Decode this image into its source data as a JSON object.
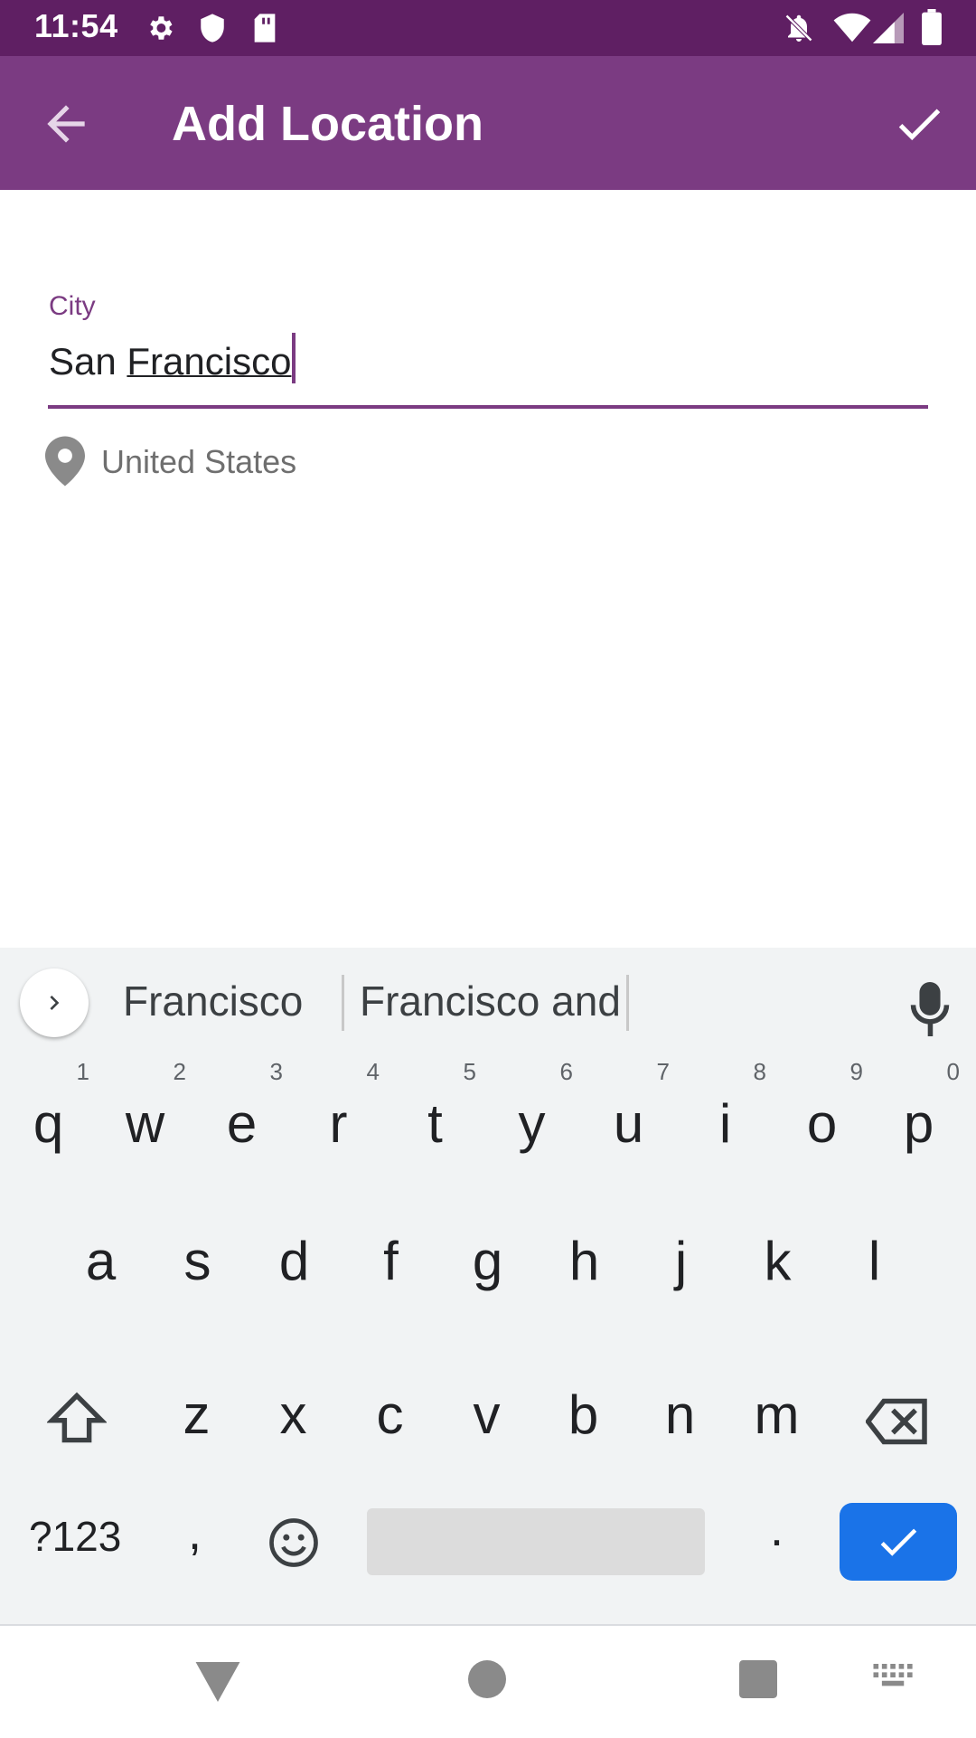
{
  "status_bar": {
    "time": "11:54",
    "icons": [
      "gear-icon",
      "shield-icon",
      "sd-card-icon",
      "notifications-off-icon",
      "wifi-icon",
      "signal-icon",
      "battery-icon"
    ]
  },
  "app_bar": {
    "title": "Add Location",
    "back_icon": "arrow-back-icon",
    "confirm_icon": "check-icon"
  },
  "form": {
    "city_label": "City",
    "city_value_plain": "San ",
    "city_value_composing": "Francisco",
    "country_icon": "location-pin-icon",
    "country": "United States"
  },
  "keyboard": {
    "suggestions": [
      "Francisco",
      "Francisco and"
    ],
    "rows": [
      [
        {
          "k": "q",
          "h": "1"
        },
        {
          "k": "w",
          "h": "2"
        },
        {
          "k": "e",
          "h": "3"
        },
        {
          "k": "r",
          "h": "4"
        },
        {
          "k": "t",
          "h": "5"
        },
        {
          "k": "y",
          "h": "6"
        },
        {
          "k": "u",
          "h": "7"
        },
        {
          "k": "i",
          "h": "8"
        },
        {
          "k": "o",
          "h": "9"
        },
        {
          "k": "p",
          "h": "0"
        }
      ],
      [
        {
          "k": "a"
        },
        {
          "k": "s"
        },
        {
          "k": "d"
        },
        {
          "k": "f"
        },
        {
          "k": "g"
        },
        {
          "k": "h"
        },
        {
          "k": "j"
        },
        {
          "k": "k"
        },
        {
          "k": "l"
        }
      ],
      [
        {
          "k": "z"
        },
        {
          "k": "x"
        },
        {
          "k": "c"
        },
        {
          "k": "v"
        },
        {
          "k": "b"
        },
        {
          "k": "n"
        },
        {
          "k": "m"
        }
      ]
    ],
    "symbols_key": "?123",
    "comma_key": ",",
    "period_key": ".",
    "emoji_icon": "emoji-icon",
    "shift_icon": "shift-icon",
    "backspace_icon": "backspace-icon",
    "enter_icon": "check-icon"
  },
  "colors": {
    "status_bar": "#5f1f63",
    "app_bar": "#7b3b82",
    "accent": "#7b3b82",
    "enter_key": "#1a73e8",
    "keyboard_bg": "#f1f3f4"
  },
  "nav_bar": {
    "icons": [
      "back-triangle-icon",
      "home-circle-icon",
      "recents-square-icon",
      "keyboard-switch-icon"
    ]
  }
}
